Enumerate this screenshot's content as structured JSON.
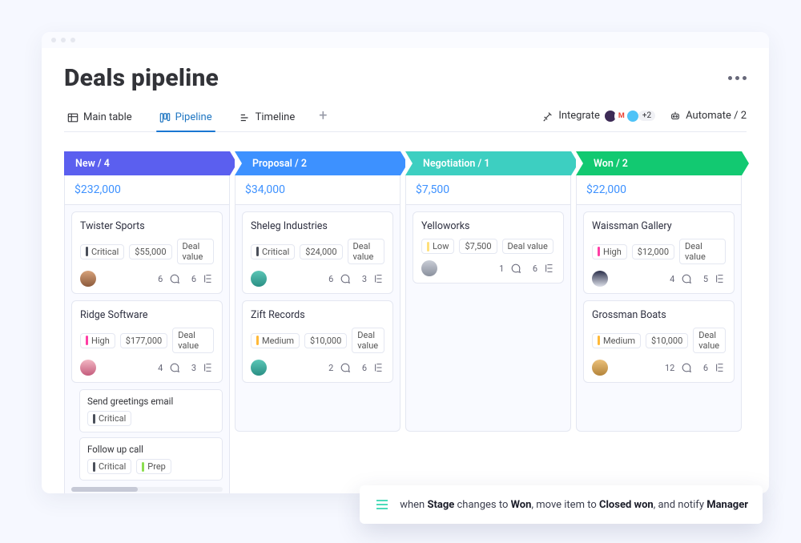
{
  "page": {
    "title": "Deals pipeline"
  },
  "tabs": {
    "main": "Main table",
    "pipeline": "Pipeline",
    "timeline": "Timeline"
  },
  "tools": {
    "integrate": "Integrate",
    "integrate_more": "+2",
    "automate": "Automate / 2"
  },
  "columns": [
    {
      "key": "new",
      "label": "New / 4",
      "sum": "$232,000",
      "cards": [
        {
          "title": "Twister Sports",
          "priority": "Critical",
          "value": "$55,000",
          "value_label": "Deal value",
          "avatar": "av1",
          "comments": 6,
          "items": 6
        },
        {
          "title": "Ridge Software",
          "priority": "High",
          "value": "$177,000",
          "value_label": "Deal value",
          "avatar": "av2",
          "comments": 4,
          "items": 3,
          "subtasks": [
            {
              "title": "Send greetings email",
              "tags": [
                "Critical"
              ]
            },
            {
              "title": "Follow up call",
              "tags": [
                "Critical",
                "Prep"
              ]
            }
          ]
        }
      ]
    },
    {
      "key": "proposal",
      "label": "Proposal / 2",
      "sum": "$34,000",
      "cards": [
        {
          "title": "Sheleg Industries",
          "priority": "Critical",
          "value": "$24,000",
          "value_label": "Deal value",
          "avatar": "av3",
          "comments": 6,
          "items": 3
        },
        {
          "title": "Zift Records",
          "priority": "Medium",
          "value": "$10,000",
          "value_label": "Deal value",
          "avatar": "av3",
          "comments": 2,
          "items": 6
        }
      ]
    },
    {
      "key": "negotiation",
      "label": "Negotiation / 1",
      "sum": "$7,500",
      "cards": [
        {
          "title": "Yelloworks",
          "priority": "Low",
          "value": "$7,500",
          "value_label": "Deal value",
          "avatar": "av4",
          "comments": 1,
          "items": 6
        }
      ]
    },
    {
      "key": "won",
      "label": "Won / 2",
      "sum": "$22,000",
      "cards": [
        {
          "title": "Waissman Gallery",
          "priority": "High",
          "value": "$12,000",
          "value_label": "Deal value",
          "avatar": "av5",
          "comments": 4,
          "items": 5
        },
        {
          "title": "Grossman Boats",
          "priority": "Medium",
          "value": "$10,000",
          "value_label": "Deal value",
          "avatar": "av6",
          "comments": 12,
          "items": 6
        }
      ]
    }
  ],
  "automation_toast": {
    "prefix": "when ",
    "b1": "Stage",
    "mid1": " changes to ",
    "b2": "Won",
    "mid2": ", move item to ",
    "b3": "Closed won",
    "mid3": ", and notify ",
    "b4": "Manager"
  },
  "colors": {
    "new": "#5b5fef",
    "proposal": "#3d91ff",
    "negotiation": "#3dcfc1",
    "won": "#12c971"
  }
}
